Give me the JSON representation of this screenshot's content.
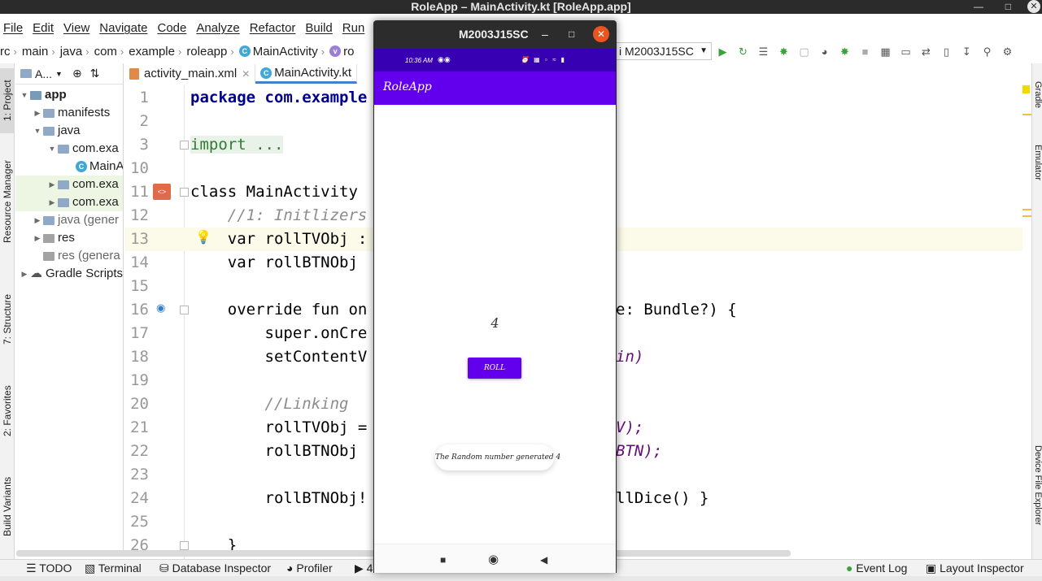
{
  "window": {
    "title": "RoleApp – MainActivity.kt [RoleApp.app]"
  },
  "menu": [
    "File",
    "Edit",
    "View",
    "Navigate",
    "Code",
    "Analyze",
    "Refactor",
    "Build",
    "Run"
  ],
  "breadcrumb": [
    "rc",
    "main",
    "java",
    "com",
    "example",
    "roleapp",
    "MainActivity",
    "ro"
  ],
  "run_config": "i M2003J15SC",
  "left_tabs": [
    "1: Project",
    "Resource Manager",
    "7: Structure",
    "2: Favorites",
    "Build Variants"
  ],
  "right_tabs": [
    "Gradle",
    "Emulator",
    "Device File Explorer"
  ],
  "project_panel": {
    "header": "A...",
    "tree": [
      {
        "label": "app",
        "indent": 0,
        "icon": "folder-icon",
        "bold": true,
        "expanded": true
      },
      {
        "label": "manifests",
        "indent": 1,
        "icon": "folder-icon",
        "expanded": false
      },
      {
        "label": "java",
        "indent": 1,
        "icon": "folder-icon",
        "expanded": true
      },
      {
        "label": "com.exa",
        "indent": 2,
        "icon": "folder-icon",
        "expanded": true
      },
      {
        "label": "MainA",
        "indent": 3,
        "icon": "kotlin-class-icon"
      },
      {
        "label": "com.exa",
        "indent": 2,
        "icon": "folder-icon",
        "expanded": false,
        "highlight": true
      },
      {
        "label": "com.exa",
        "indent": 2,
        "icon": "folder-icon",
        "expanded": false,
        "highlight": true
      },
      {
        "label": "java (gener",
        "indent": 1,
        "icon": "folder-icon",
        "expanded": false,
        "muted": true
      },
      {
        "label": "res",
        "indent": 1,
        "icon": "folder-icon",
        "expanded": false
      },
      {
        "label": "res (genera",
        "indent": 1,
        "icon": "folder-icon",
        "muted": true
      },
      {
        "label": "Gradle Scripts",
        "indent": 0,
        "icon": "gradle-icon",
        "expanded": false
      }
    ]
  },
  "tabs": [
    {
      "label": "activity_main.xml",
      "active": false
    },
    {
      "label": "MainActivity.kt",
      "active": true
    }
  ],
  "code": {
    "line_numbers": [
      "1",
      "2",
      "3",
      "10",
      "11",
      "12",
      "13",
      "14",
      "15",
      "16",
      "17",
      "18",
      "19",
      "20",
      "21",
      "22",
      "23",
      "24",
      "25",
      "26"
    ],
    "lines": [
      "package com.example",
      "",
      "import ...",
      "",
      "class MainActivity",
      "    //1: Initlizers",
      "    var rollTVObj :",
      "    var rollBTNObj",
      "",
      "    override fun on",
      "        super.onCre",
      "        setContentV",
      "",
      "        //Linking",
      "        rollTVObj =",
      "        rollBTNObj",
      "",
      "        rollBTNObj!",
      "",
      "    }"
    ],
    "right_fragments": {
      "line16": "e: Bundle?) {",
      "line18": "in)",
      "line21": "V);",
      "line22": "BTN);",
      "line24": "llDice() }"
    }
  },
  "emulator": {
    "title": "M2003J15SC",
    "status_time": "10:36 AM",
    "app_title": "RoleApp",
    "roll_value": "4",
    "button_label": "ROLL",
    "toast": "The Random number generated 4"
  },
  "bottom_tools": [
    "TODO",
    "Terminal",
    "Database Inspector",
    "Profiler",
    "4",
    "Event Log",
    "Layout Inspector"
  ]
}
